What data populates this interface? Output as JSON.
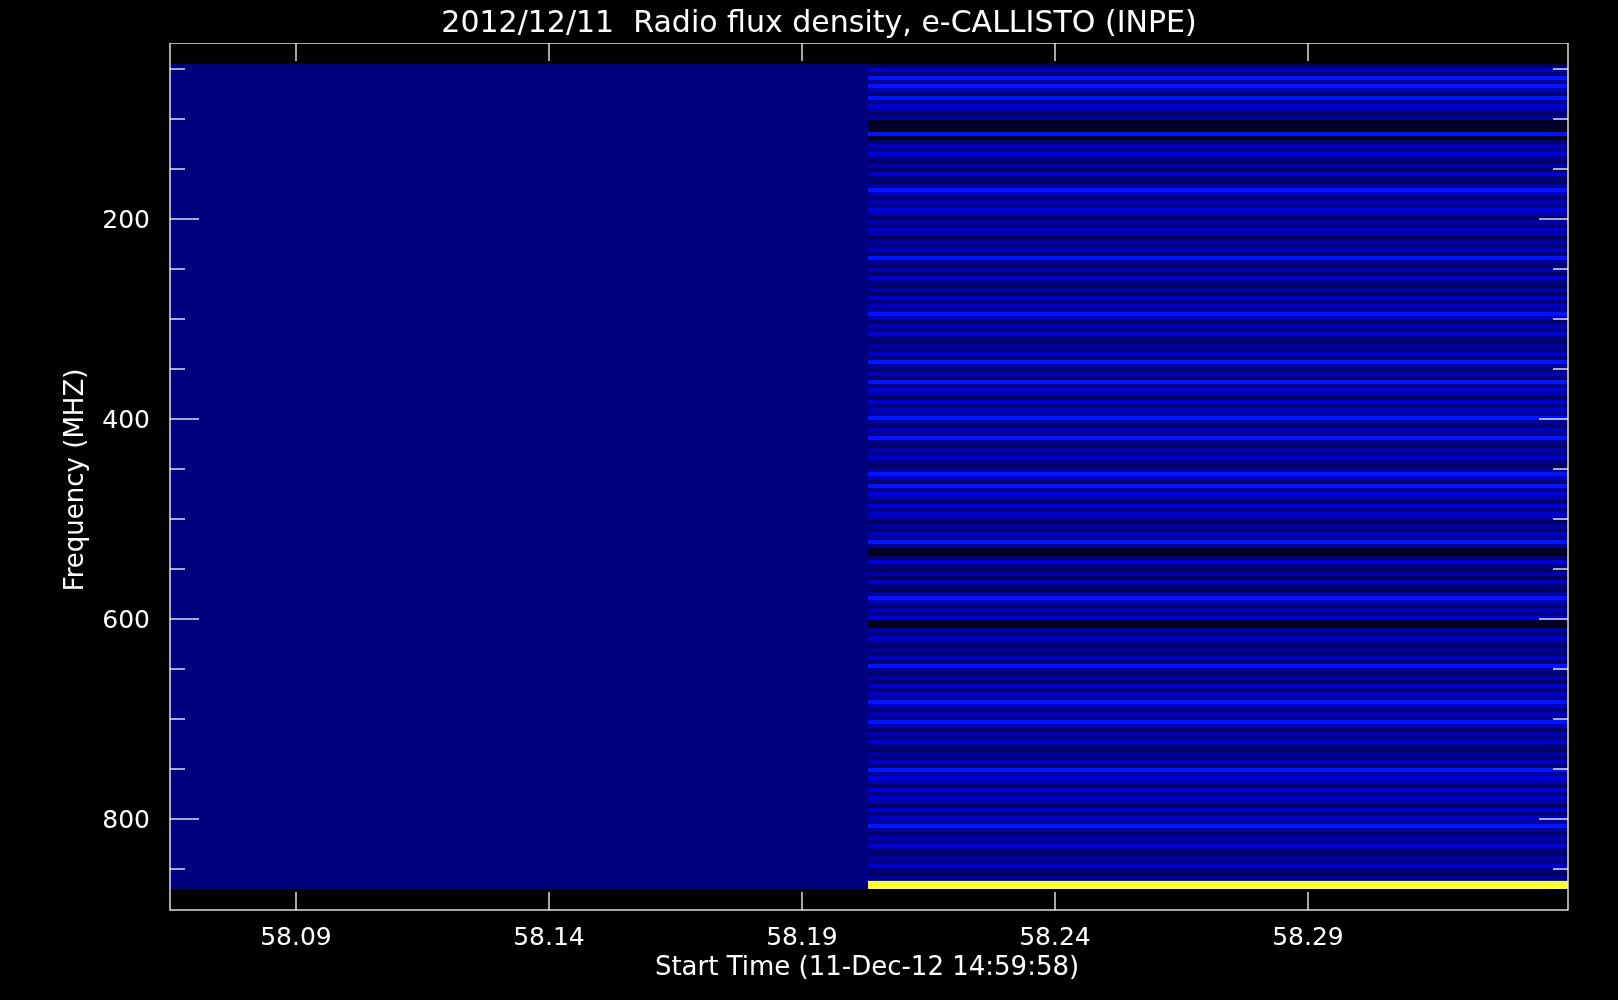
{
  "title": "2012/12/11  Radio flux density, e-CALLISTO (INPE)",
  "x_axis": {
    "label": "Start Time (11-Dec-12 14:59:58)",
    "ticks": [
      "58.09",
      "58.14",
      "58.19",
      "58.24",
      "58.29"
    ]
  },
  "y_axis": {
    "label": "Frequency (MHZ)",
    "ticks": [
      "200",
      "400",
      "600",
      "800"
    ]
  }
}
